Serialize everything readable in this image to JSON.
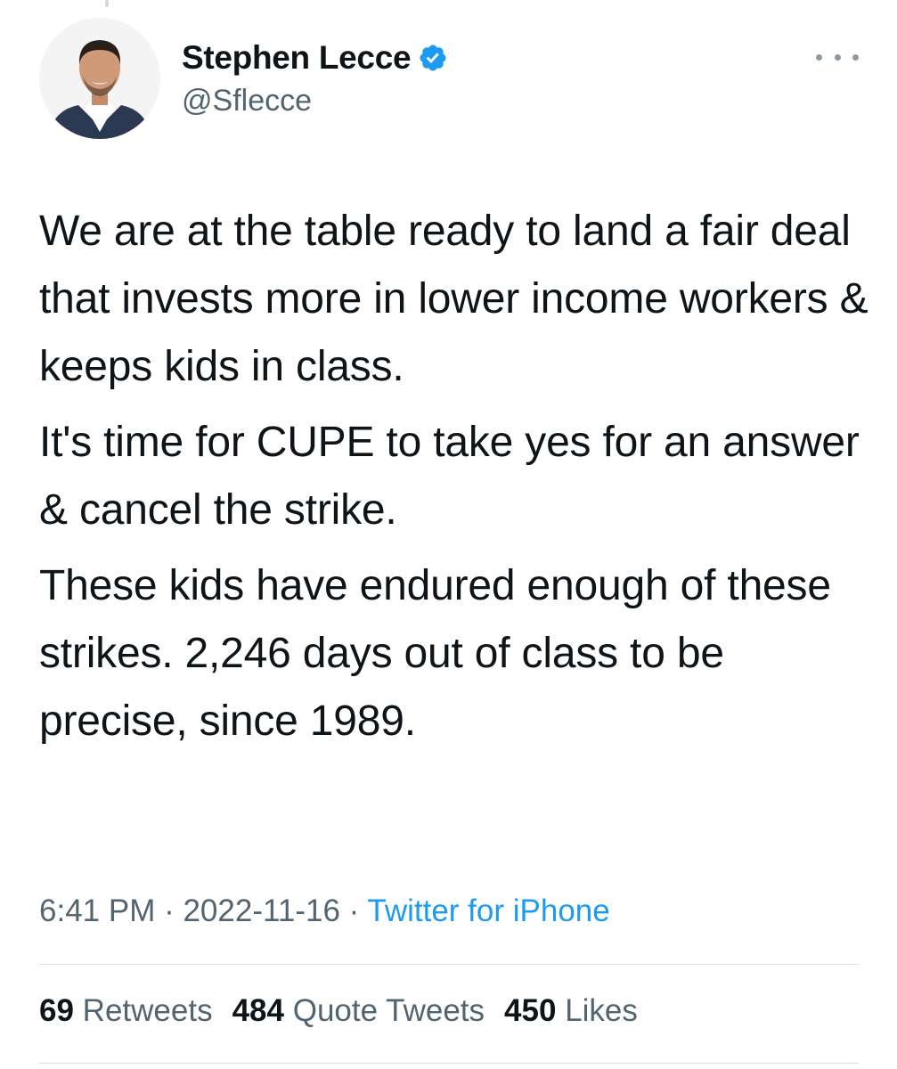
{
  "author": {
    "display_name": "Stephen Lecce",
    "handle": "@Sflecce",
    "verified": true,
    "avatar_icon": "profile-photo"
  },
  "tweet": {
    "paragraphs": [
      "We are at the table ready to land a fair deal that invests more in lower income workers & keeps kids in class.",
      "It's time for CUPE to take yes for an answer & cancel the strike.",
      "These kids have endured enough of these strikes. 2,246 days out of class to be precise, since 1989."
    ]
  },
  "meta": {
    "time": "6:41 PM",
    "separator": " · ",
    "date": "2022-11-16",
    "source": "Twitter for iPhone"
  },
  "stats": {
    "retweets_count": "69",
    "retweets_label": "Retweets",
    "quote_tweets_count": "484",
    "quote_tweets_label": "Quote Tweets",
    "likes_count": "450",
    "likes_label": "Likes"
  },
  "colors": {
    "accent": "#1d9bf0",
    "muted_text": "#536471",
    "text": "#0f1419"
  },
  "icons": {
    "verified": "verified-badge-icon",
    "more": "more-options-icon"
  }
}
